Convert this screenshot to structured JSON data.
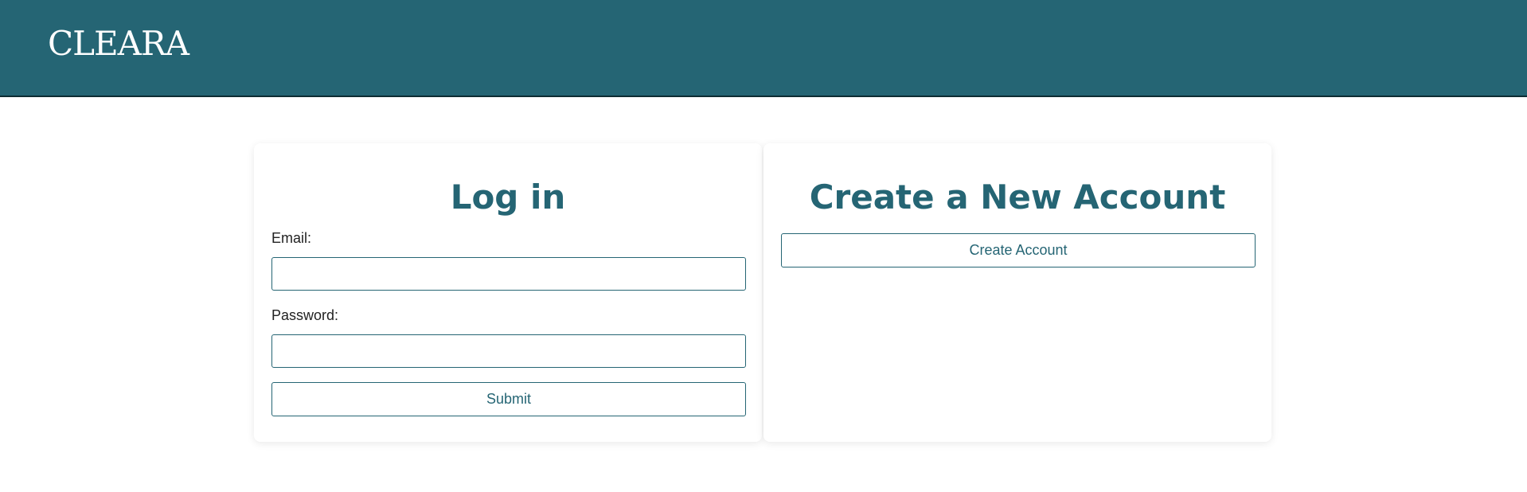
{
  "header": {
    "logo": "CLEARA"
  },
  "login": {
    "title": "Log in",
    "email_label": "Email:",
    "email_value": "",
    "password_label": "Password:",
    "password_value": "",
    "submit_label": "Submit"
  },
  "register": {
    "title": "Create a New Account",
    "create_label": "Create Account"
  },
  "colors": {
    "brand": "#256574",
    "background": "#ffffff"
  }
}
